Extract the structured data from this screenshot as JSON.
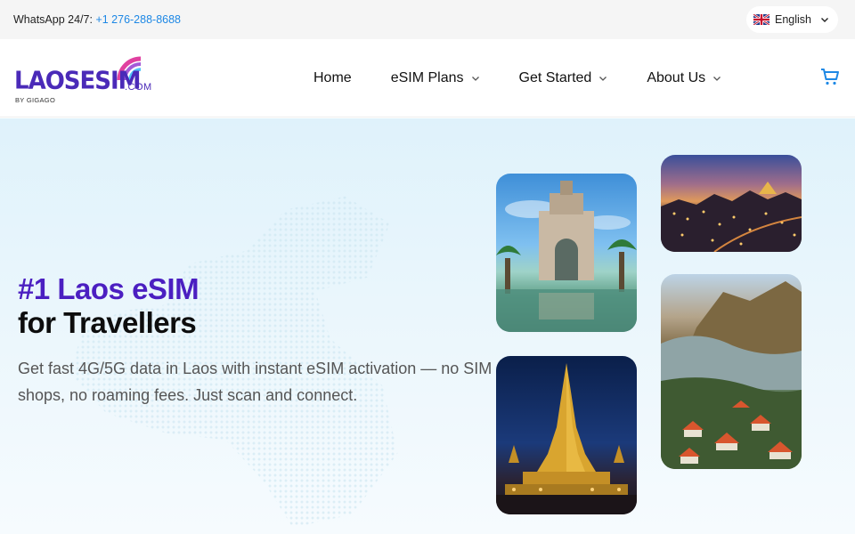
{
  "topbar": {
    "whatsapp_label": "WhatsApp 24/7:",
    "whatsapp_number": "+1 276-288-8688",
    "language": "English"
  },
  "header": {
    "logo_text": "LAOSESIM",
    "logo_suffix": ".COM",
    "logo_byline": "BY GIGAGO",
    "nav": [
      {
        "label": "Home",
        "has_dropdown": false
      },
      {
        "label": "eSIM Plans",
        "has_dropdown": true
      },
      {
        "label": "Get Started",
        "has_dropdown": true
      },
      {
        "label": "About Us",
        "has_dropdown": true
      }
    ],
    "cart_icon": "cart-icon"
  },
  "hero": {
    "headline_accent": "#1 Laos eSIM",
    "headline_rest": "for Travellers",
    "subtitle": "Get fast 4G/5G data in Laos with instant eSIM activation — no SIM shops, no roaming fees. Just scan and connect.",
    "images": [
      "patuxai-monument-photo",
      "city-night-skyline-photo",
      "golden-stupa-photo",
      "riverside-village-photo"
    ]
  },
  "colors": {
    "brand_purple": "#4b1fc1",
    "link_blue": "#1e88e5",
    "hero_bg": "#dff2fb",
    "logo_arc": "#e040a0"
  }
}
